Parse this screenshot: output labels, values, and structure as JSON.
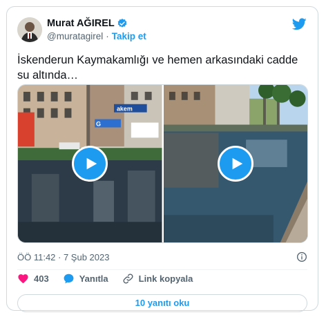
{
  "author": {
    "name": "Murat AĞIREL",
    "handle": "@muratagirel",
    "separator": "·",
    "follow_label": "Takip et"
  },
  "tweet": {
    "text": "İskenderun Kaymakamlığı ve hemen arkasındaki cadde su altında…"
  },
  "media": {
    "left_sign_1": "akem",
    "left_sign_2": "G"
  },
  "meta": {
    "timestamp": "ÖÖ 11:42 · 7 Şub 2023"
  },
  "actions": {
    "likes": "403",
    "reply_label": "Yanıtla",
    "copy_link_label": "Link kopyala"
  },
  "footer": {
    "replies_label": "10 yanıtı oku"
  },
  "colors": {
    "accent": "#1d9bf0",
    "like": "#f91880"
  }
}
